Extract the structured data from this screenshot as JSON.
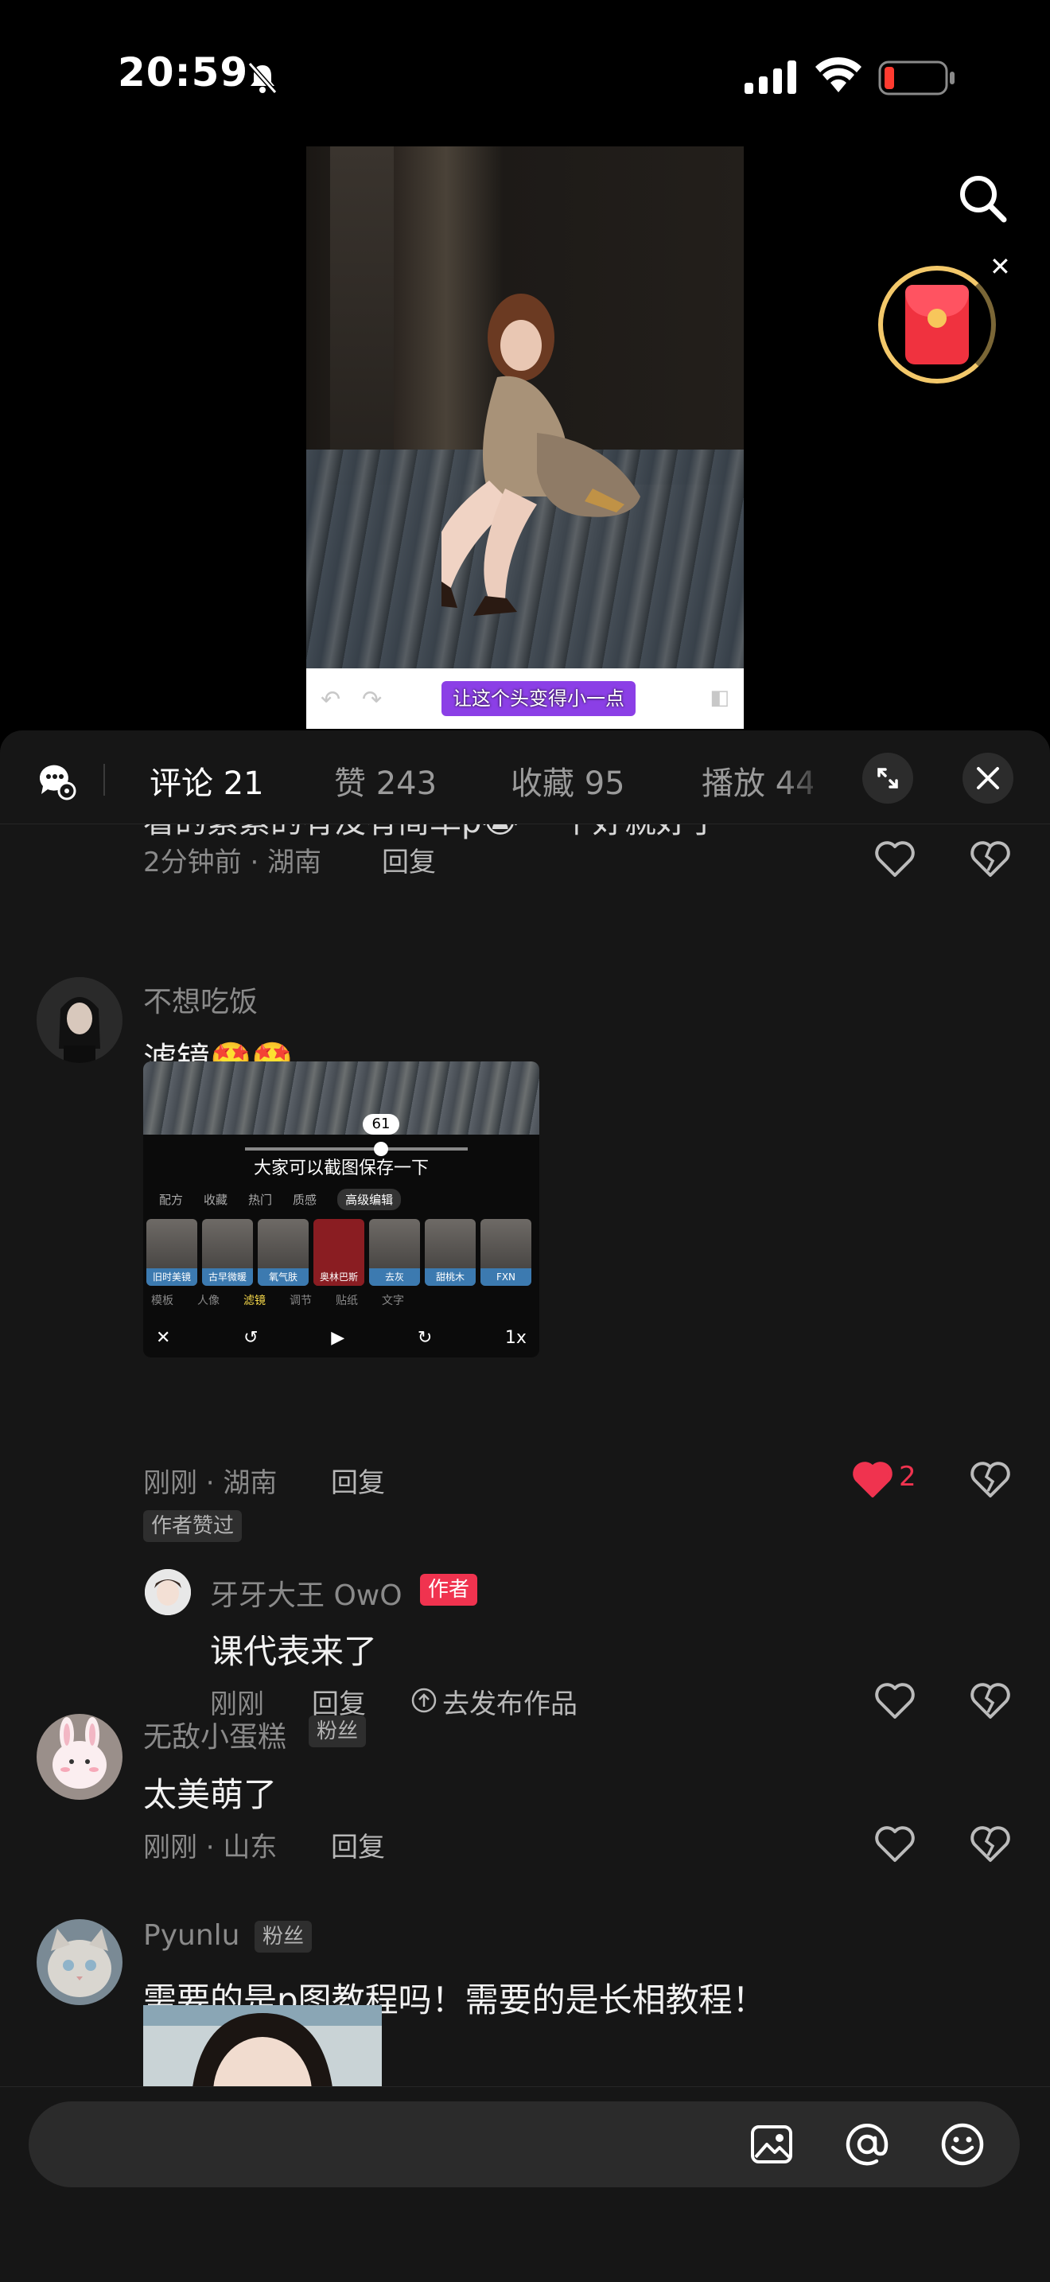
{
  "status_bar": {
    "time": "20:59"
  },
  "video": {
    "caption": "让这个头变得小一点",
    "undo_icon": "undo-icon",
    "redo_icon": "redo-icon"
  },
  "tabs": [
    {
      "label": "评论 21",
      "active": true
    },
    {
      "label": "赞 243"
    },
    {
      "label": "收藏 95"
    },
    {
      "label": "播放 44"
    }
  ],
  "comments": {
    "cut_text": "看的素素的有没有简单p😭 一个好就好了",
    "first": {
      "time_location": "2分钟前 · 湖南",
      "reply": "回复"
    },
    "c1": {
      "username": "不想吃饭",
      "text": "滤镜🤩🤩",
      "time_location": "刚刚 · 湖南",
      "reply": "回复",
      "like_count": "2",
      "author_liked": "作者赞过",
      "screenshot": {
        "value": "61",
        "caption": "大家可以截图保存一下",
        "tabs": [
          "配方",
          "收藏",
          "热门",
          "质感",
          "高级编辑"
        ],
        "filters": [
          "旧时美镜",
          "古早微暖",
          "氧气肤",
          "奥林巴斯",
          "去灰",
          "甜桃木",
          "FXN"
        ],
        "categories": [
          "模板",
          "人像",
          "滤镜",
          "调节",
          "贴纸",
          "文字"
        ],
        "speed": "1x"
      }
    },
    "r1": {
      "username": "牙牙大王 OwO",
      "badge": "作者",
      "text": "课代表来了",
      "time": "刚刚",
      "reply": "回复",
      "publish": "去发布作品"
    },
    "c2": {
      "username": "无敌小蛋糕",
      "badge": "粉丝",
      "text": "太美萌了",
      "time_location": "刚刚 · 山东",
      "reply": "回复"
    },
    "c3": {
      "username": "Pyunlu",
      "badge": "粉丝",
      "text": "需要的是p图教程吗！需要的是长相教程！"
    }
  },
  "input_bar": {
    "placeholder": "",
    "icons": [
      "image-icon",
      "at-icon",
      "emoji-icon"
    ]
  },
  "colors": {
    "accent_red": "#f0334f",
    "panel_bg": "#161616"
  }
}
